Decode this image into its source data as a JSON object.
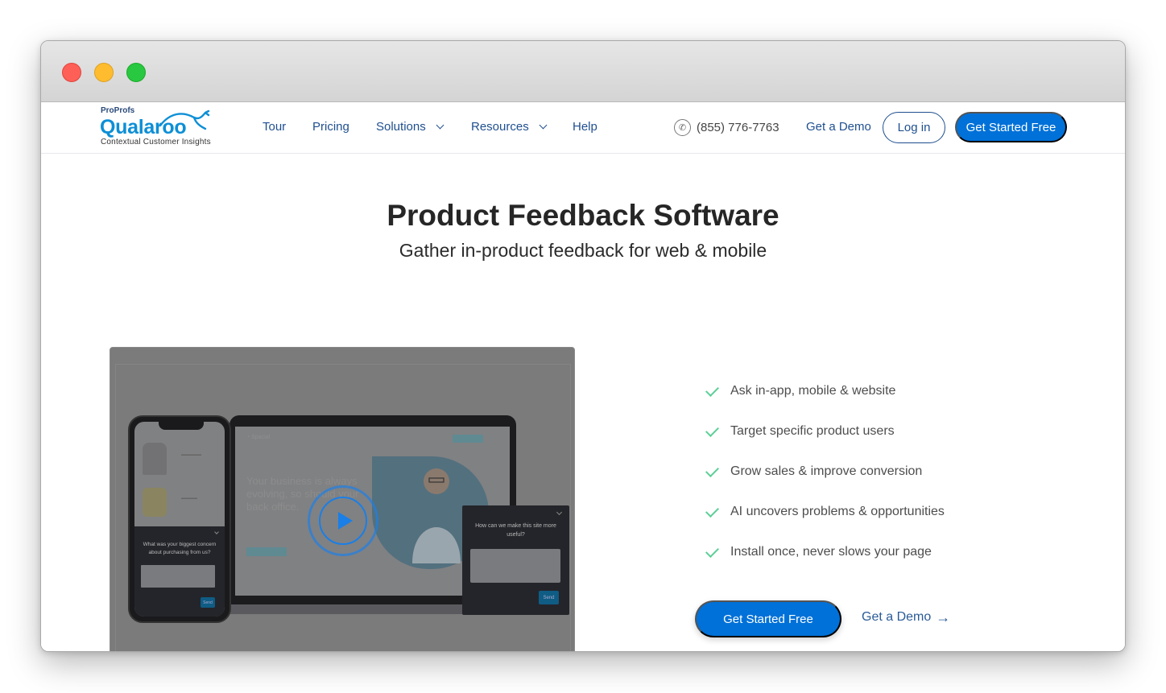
{
  "window": {
    "controls": [
      "close",
      "minimize",
      "maximize"
    ]
  },
  "logo": {
    "top_text": "ProProfs",
    "brand": "Qualaroo",
    "tagline": "Contextual Customer Insights"
  },
  "nav": {
    "items": [
      {
        "label": "Tour",
        "has_dropdown": false
      },
      {
        "label": "Pricing",
        "has_dropdown": false
      },
      {
        "label": "Solutions",
        "has_dropdown": true
      },
      {
        "label": "Resources",
        "has_dropdown": true
      },
      {
        "label": "Help",
        "has_dropdown": false
      }
    ],
    "phone": "(855) 776-7763",
    "phone_icon": "phone-icon",
    "demo_label": "Get a Demo",
    "login_label": "Log in",
    "cta_label": "Get Started Free"
  },
  "hero": {
    "title": "Product Feedback Software",
    "subtitle": "Gather in-product feedback for web & mobile"
  },
  "video": {
    "play_icon": "play-icon",
    "laptop_headline": "Your business is always evolving, so should your back office.",
    "phone_survey_question": "What was your biggest concern about purchasing from us?",
    "phone_send_label": "Send",
    "popup_question": "How can we make this site more useful?",
    "popup_send_label": "Send"
  },
  "features": [
    "Ask in-app, mobile & website",
    "Target specific product users",
    "Grow sales & improve conversion",
    "AI uncovers problems & opportunities",
    "Install once, never slows your page"
  ],
  "cta": {
    "primary_label": "Get Started Free",
    "secondary_label": "Get a Demo",
    "secondary_icon": "arrow-right-icon"
  },
  "colors": {
    "primary": "#0071d8",
    "nav_text": "#1f4f8f",
    "check": "#5ccf97",
    "brand": "#0d8fd6"
  }
}
